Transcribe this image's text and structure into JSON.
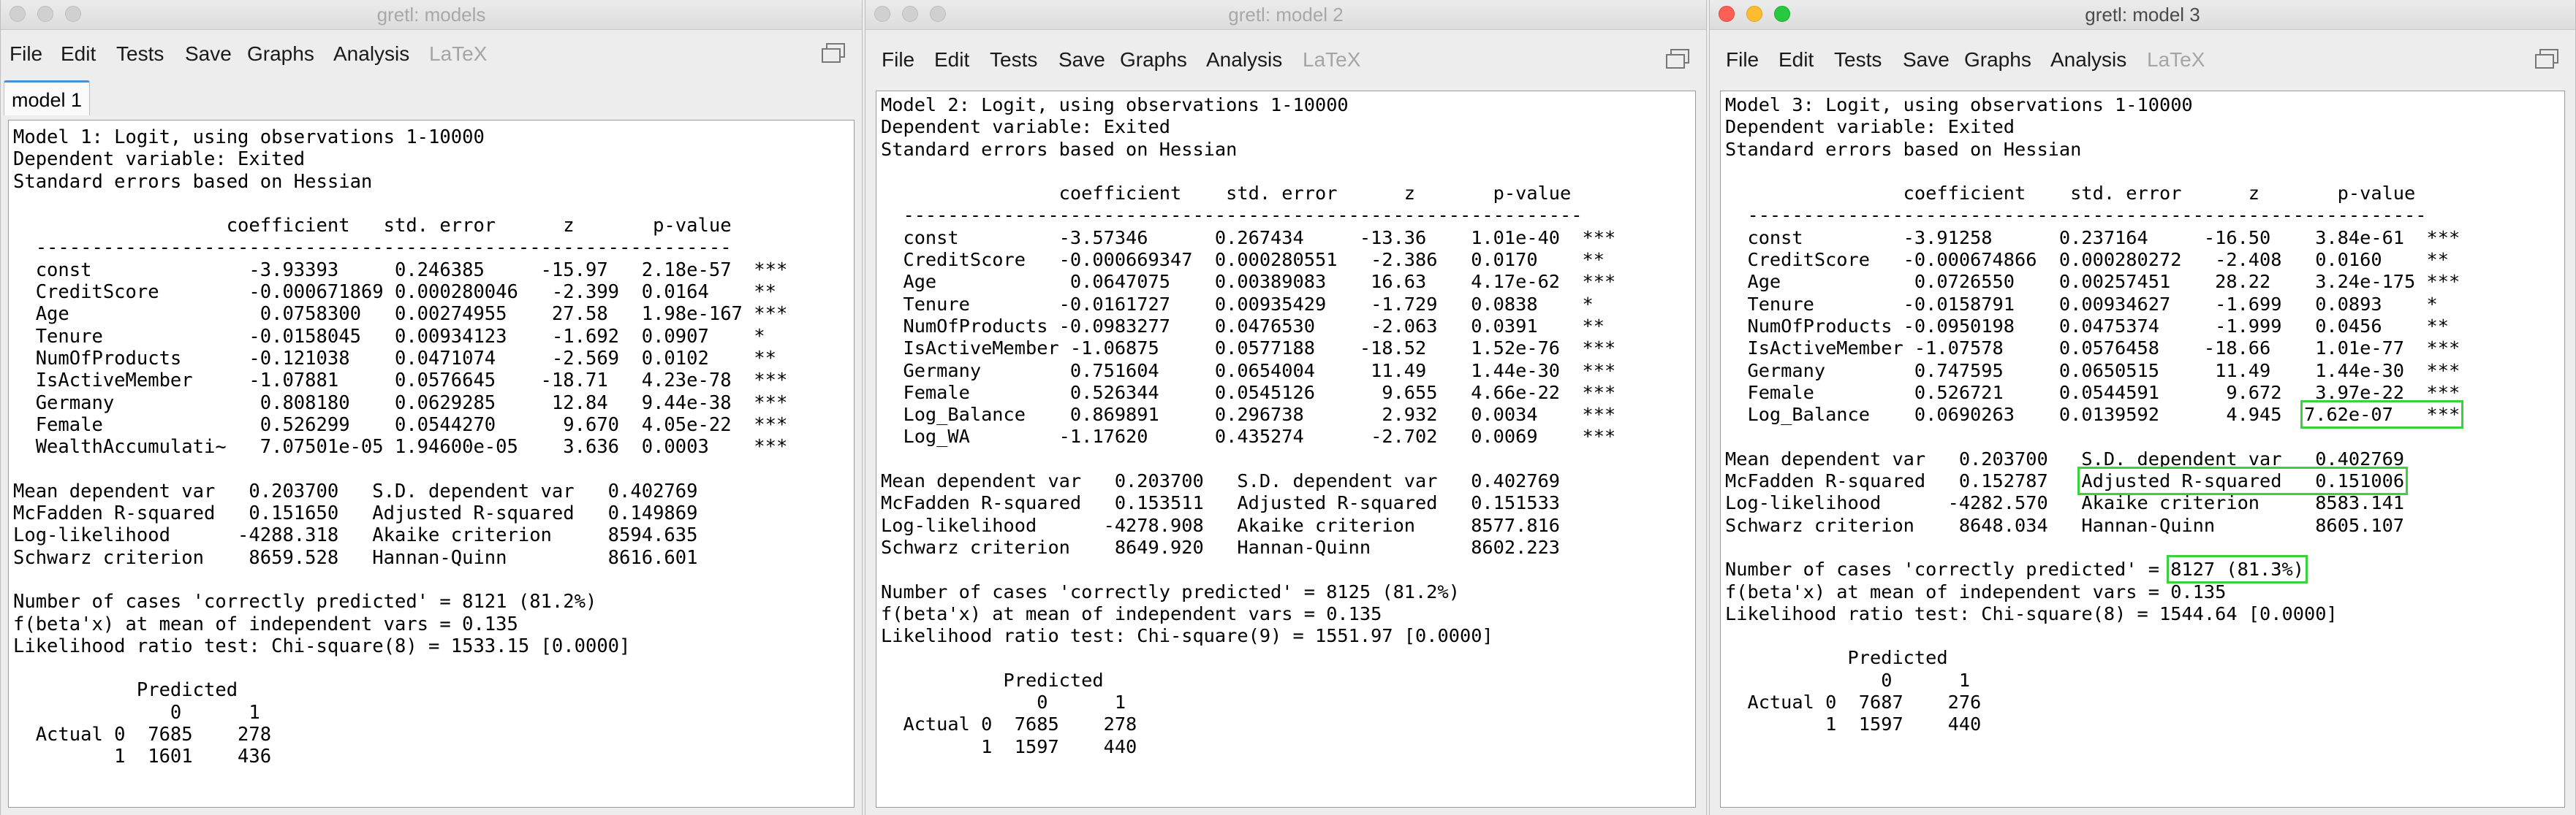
{
  "windows": [
    {
      "title": "gretl: models",
      "menu": [
        "File",
        "Edit",
        "Tests",
        "Save",
        "Graphs",
        "Analysis",
        "LaTeX"
      ],
      "tab": "model 1",
      "lines": [
        "Model 1: Logit, using observations 1-10000",
        "Dependent variable: Exited",
        "Standard errors based on Hessian",
        "",
        "                   coefficient   std. error      z       p-value",
        "  --------------------------------------------------------------",
        "  const              -3.93393     0.246385     -15.97   2.18e-57  ***",
        "  CreditScore        -0.000671869 0.000280046   -2.399  0.0164    **",
        "  Age                 0.0758300   0.00274955    27.58   1.98e-167 ***",
        "  Tenure             -0.0158045   0.00934123    -1.692  0.0907    *",
        "  NumOfProducts      -0.121038    0.0471074     -2.569  0.0102    **",
        "  IsActiveMember     -1.07881     0.0576645    -18.71   4.23e-78  ***",
        "  Germany             0.808180    0.0629285     12.84   9.44e-38  ***",
        "  Female              0.526299    0.0544270      9.670  4.05e-22  ***",
        "  WealthAccumulati~   7.07501e-05 1.94600e-05    3.636  0.0003    ***",
        "",
        "Mean dependent var   0.203700   S.D. dependent var   0.402769",
        "McFadden R-squared   0.151650   Adjusted R-squared   0.149869",
        "Log-likelihood      -4288.318   Akaike criterion     8594.635",
        "Schwarz criterion    8659.528   Hannan-Quinn         8616.601",
        "",
        "Number of cases 'correctly predicted' = 8121 (81.2%)",
        "f(beta'x) at mean of independent vars = 0.135",
        "Likelihood ratio test: Chi-square(8) = 1533.15 [0.0000]",
        "",
        "           Predicted",
        "              0      1",
        "  Actual 0  7685    278",
        "         1  1601    436"
      ]
    },
    {
      "title": "gretl: model 2",
      "menu": [
        "File",
        "Edit",
        "Tests",
        "Save",
        "Graphs",
        "Analysis",
        "LaTeX"
      ],
      "lines": [
        "Model 2: Logit, using observations 1-10000",
        "Dependent variable: Exited",
        "Standard errors based on Hessian",
        "",
        "                coefficient    std. error      z       p-value",
        "  -------------------------------------------------------------",
        "  const         -3.57346      0.267434     -13.36    1.01e-40  ***",
        "  CreditScore   -0.000669347  0.000280551   -2.386   0.0170    **",
        "  Age            0.0647075    0.00389083    16.63    4.17e-62  ***",
        "  Tenure        -0.0161727    0.00935429    -1.729   0.0838    *",
        "  NumOfProducts -0.0983277    0.0476530     -2.063   0.0391    **",
        "  IsActiveMember -1.06875     0.0577188    -18.52    1.52e-76  ***",
        "  Germany        0.751604     0.0654004     11.49    1.44e-30  ***",
        "  Female         0.526344     0.0545126      9.655   4.66e-22  ***",
        "  Log_Balance    0.869891     0.296738       2.932   0.0034    ***",
        "  Log_WA        -1.17620      0.435274      -2.702   0.0069    ***",
        "",
        "Mean dependent var   0.203700   S.D. dependent var   0.402769",
        "McFadden R-squared   0.153511   Adjusted R-squared   0.151533",
        "Log-likelihood      -4278.908   Akaike criterion     8577.816",
        "Schwarz criterion    8649.920   Hannan-Quinn         8602.223",
        "",
        "Number of cases 'correctly predicted' = 8125 (81.2%)",
        "f(beta'x) at mean of independent vars = 0.135",
        "Likelihood ratio test: Chi-square(9) = 1551.97 [0.0000]",
        "",
        "           Predicted",
        "              0      1",
        "  Actual 0  7685    278",
        "         1  1597    440"
      ]
    },
    {
      "title": "gretl: model 3",
      "menu": [
        "File",
        "Edit",
        "Tests",
        "Save",
        "Graphs",
        "Analysis",
        "LaTeX"
      ],
      "lines": [
        "Model 3: Logit, using observations 1-10000",
        "Dependent variable: Exited",
        "Standard errors based on Hessian",
        "",
        "                coefficient    std. error      z       p-value",
        "  -------------------------------------------------------------",
        "  const         -3.91258      0.237164     -16.50    3.84e-61  ***",
        "  CreditScore   -0.000674866  0.000280272   -2.408   0.0160    **",
        "  Age            0.0726550    0.00257451    28.22    3.24e-175 ***",
        "  Tenure        -0.0158791    0.00934627    -1.699   0.0893    *",
        "  NumOfProducts -0.0950198    0.0475374     -1.999   0.0456    **",
        "  IsActiveMember -1.07578     0.0576458    -18.66    1.01e-77  ***",
        "  Germany        0.747595     0.0650515     11.49    1.44e-30  ***",
        "  Female         0.526721     0.0544591      9.672   3.97e-22  ***",
        "  Log_Balance    0.0690263    0.0139592      4.945",
        "",
        "Mean dependent var   0.203700   S.D. dependent var   0.402769",
        "McFadden R-squared   0.152787 ",
        "Log-likelihood      -4282.570   Akaike criterion     8583.141",
        "Schwarz criterion    8648.034   Hannan-Quinn         8605.107",
        "",
        "Number of cases 'correctly predicted' = ",
        "f(beta'x) at mean of independent vars = 0.135",
        "Likelihood ratio test: Chi-square(8) = 1544.64 [0.0000]",
        "",
        "           Predicted",
        "              0      1",
        "  Actual 0  7687    276",
        "         1  1597    440"
      ],
      "highlights": {
        "pvalue_log_balance": "7.62e-07   ***",
        "adj_rsq": "Adjusted R-squared   0.151006",
        "correct_pred": "8127 (81.3%)"
      }
    }
  ]
}
